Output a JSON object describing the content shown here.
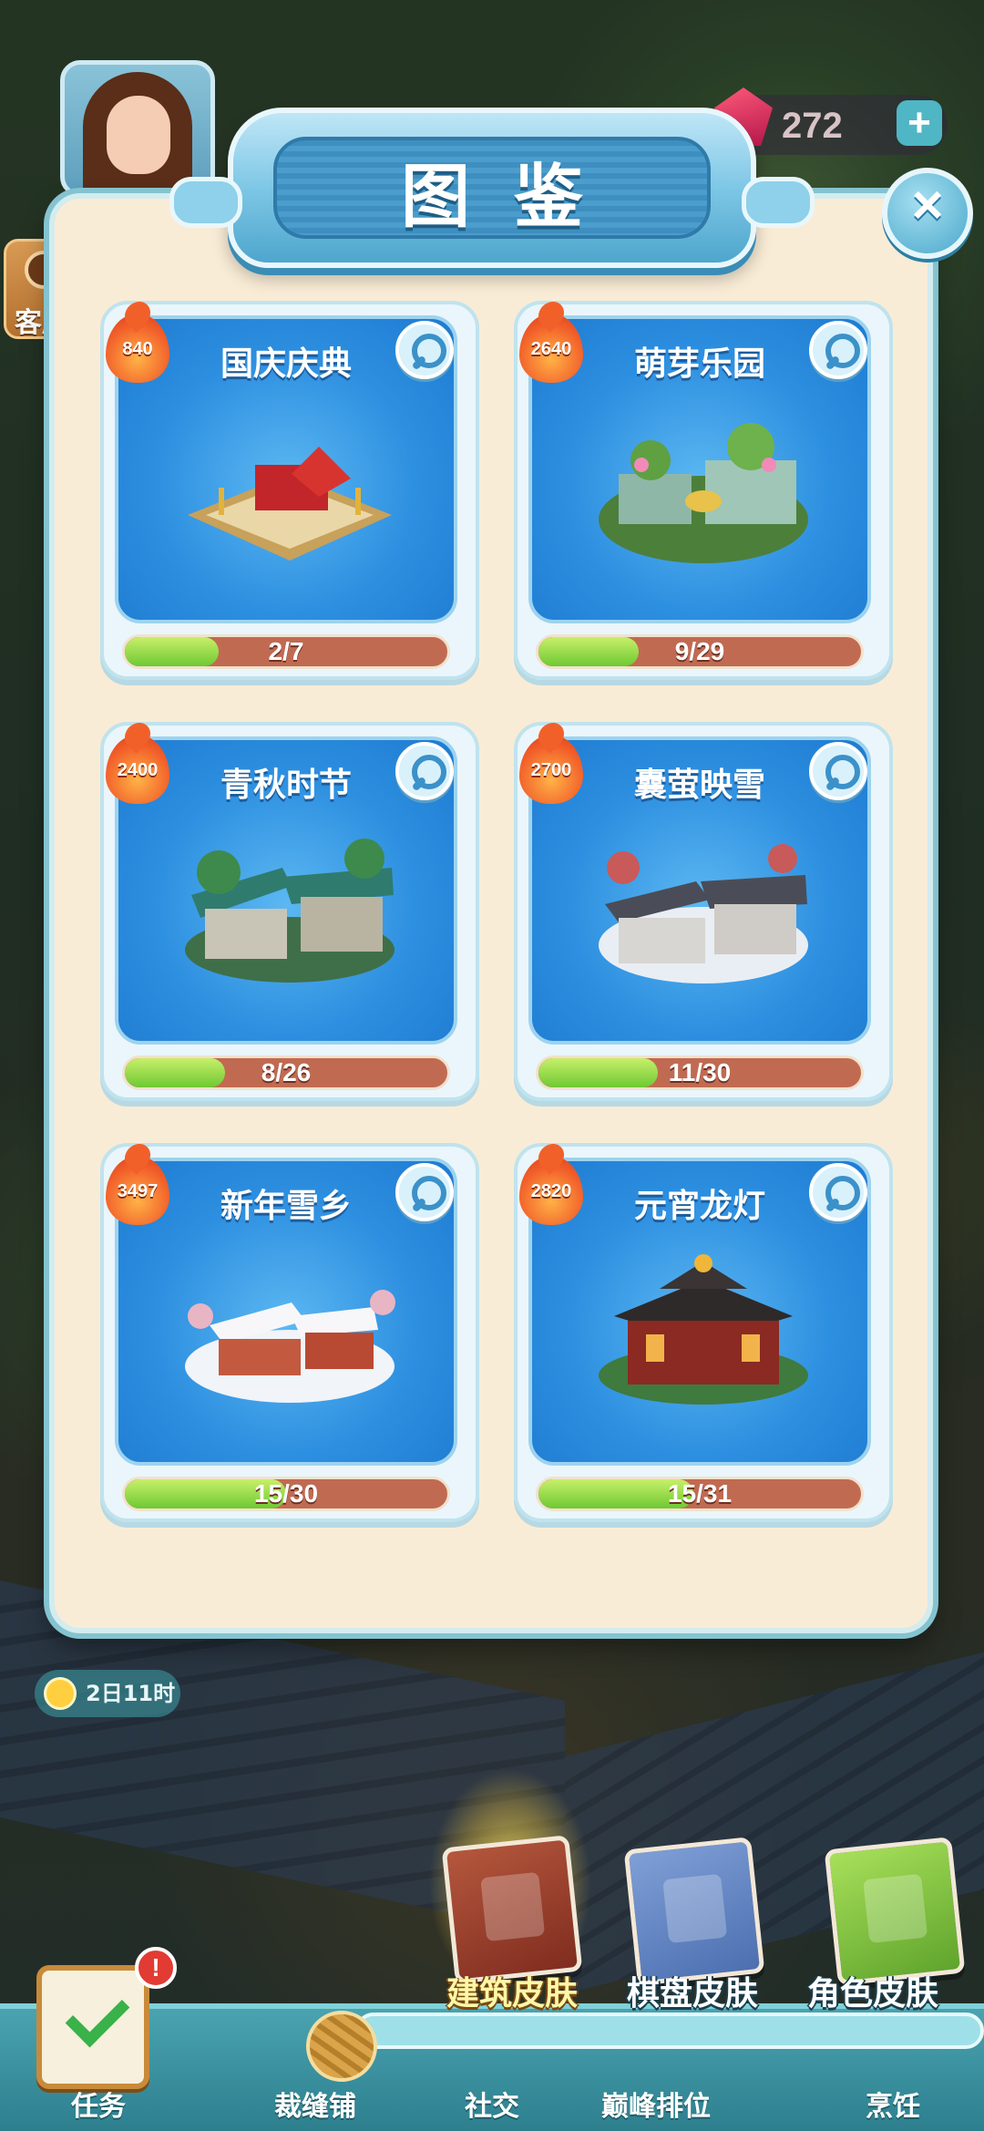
{
  "hud": {
    "gem_count": "272",
    "gem_plus": "+",
    "service_label": "客服",
    "timer": "2日11时"
  },
  "modal": {
    "title": "图鉴",
    "close_label": "×"
  },
  "collections": [
    {
      "name": "国庆庆典",
      "heat": "840",
      "progress_text": "2/7",
      "progress": 0.29,
      "theme": "festival"
    },
    {
      "name": "萌芽乐园",
      "heat": "2640",
      "progress_text": "9/29",
      "progress": 0.31,
      "theme": "garden"
    },
    {
      "name": "青秋时节",
      "heat": "2400",
      "progress_text": "8/26",
      "progress": 0.31,
      "theme": "autumn"
    },
    {
      "name": "囊萤映雪",
      "heat": "2700",
      "progress_text": "11/30",
      "progress": 0.37,
      "theme": "snow"
    },
    {
      "name": "新年雪乡",
      "heat": "3497",
      "progress_text": "15/30",
      "progress": 0.5,
      "theme": "newyear"
    },
    {
      "name": "元宵龙灯",
      "heat": "2820",
      "progress_text": "15/31",
      "progress": 0.48,
      "theme": "lantern"
    }
  ],
  "book_tabs": [
    {
      "label": "建筑皮肤",
      "active": true
    },
    {
      "label": "棋盘皮肤",
      "active": false
    },
    {
      "label": "角色皮肤",
      "active": false
    }
  ],
  "bottom_nav": {
    "task": "任务",
    "tailor": "裁缝铺",
    "social": "社交",
    "ranking": "巅峰排位",
    "cooking": "烹饪",
    "alert": "!"
  },
  "colors": {
    "panel_bg": "#f9ecd6",
    "card_blue": "#2d8fe0",
    "progress_fill": "#6ec933",
    "progress_track": "#c16a52",
    "heat_flame": "#f2602a"
  }
}
